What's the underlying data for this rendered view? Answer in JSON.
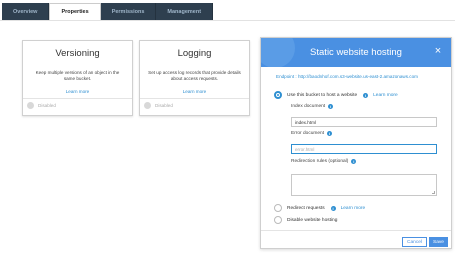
{
  "tabs": [
    {
      "label": "Overview"
    },
    {
      "label": "Properties"
    },
    {
      "label": "Permissions"
    },
    {
      "label": "Management"
    }
  ],
  "cards": {
    "versioning": {
      "title": "Versioning",
      "description": "Keep multiple versions of an object in the same bucket.",
      "link": "Learn more",
      "status": "Disabled"
    },
    "logging": {
      "title": "Logging",
      "description": "Set up access log records that provide details about access requests.",
      "link": "Learn more",
      "status": "Disabled"
    }
  },
  "modal": {
    "title": "Static website hosting",
    "close": "×",
    "endpoint": "Endpoint : http://baodnhof.com.s3-website.us-east-2.amazonaws.com",
    "option_host": "Use this bucket to host a website",
    "learn_more": "Learn more",
    "index_label": "Index document",
    "index_value": "index.html",
    "error_label": "Error document",
    "error_placeholder": "error.html",
    "redirection_label": "Redirection rules (optional)",
    "option_redirect": "Redirect requests",
    "option_disable": "Disable website hosting",
    "cancel": "Cancel",
    "save": "Save"
  },
  "colors": {
    "tab_bg": "#2e3f4f",
    "accent": "#4a90e2",
    "link": "#2e8fd1"
  }
}
